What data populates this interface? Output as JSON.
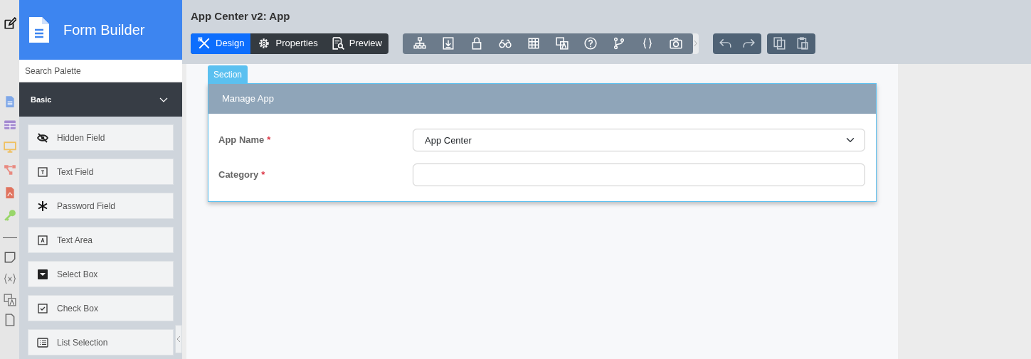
{
  "sidebar": {
    "title": "Form Builder",
    "search": {
      "placeholder": "Search Palette"
    },
    "category": {
      "label": "Basic",
      "expanded": true
    },
    "items": [
      {
        "label": "Hidden Field",
        "kind": "hidden"
      },
      {
        "label": "Text Field",
        "kind": "textfield"
      },
      {
        "label": "Password Field",
        "kind": "password"
      },
      {
        "label": "Text Area",
        "kind": "textarea"
      },
      {
        "label": "Select Box",
        "kind": "select"
      },
      {
        "label": "Check Box",
        "kind": "checkbox"
      },
      {
        "label": "List Selection",
        "kind": "list"
      }
    ]
  },
  "header": {
    "title": "App Center v2: App"
  },
  "tabs": [
    {
      "label": "Design",
      "kind": "design",
      "selected": true
    },
    {
      "label": "Properties",
      "kind": "properties",
      "selected": false
    },
    {
      "label": "Preview",
      "kind": "preview",
      "selected": false
    }
  ],
  "canvas": {
    "section_tag": "Section",
    "section_title": "Manage App",
    "fields": [
      {
        "label": "App Name",
        "required_mark": "*",
        "kind": "select",
        "value": "App Center"
      },
      {
        "label": "Category",
        "required_mark": "*",
        "kind": "text"
      }
    ]
  }
}
